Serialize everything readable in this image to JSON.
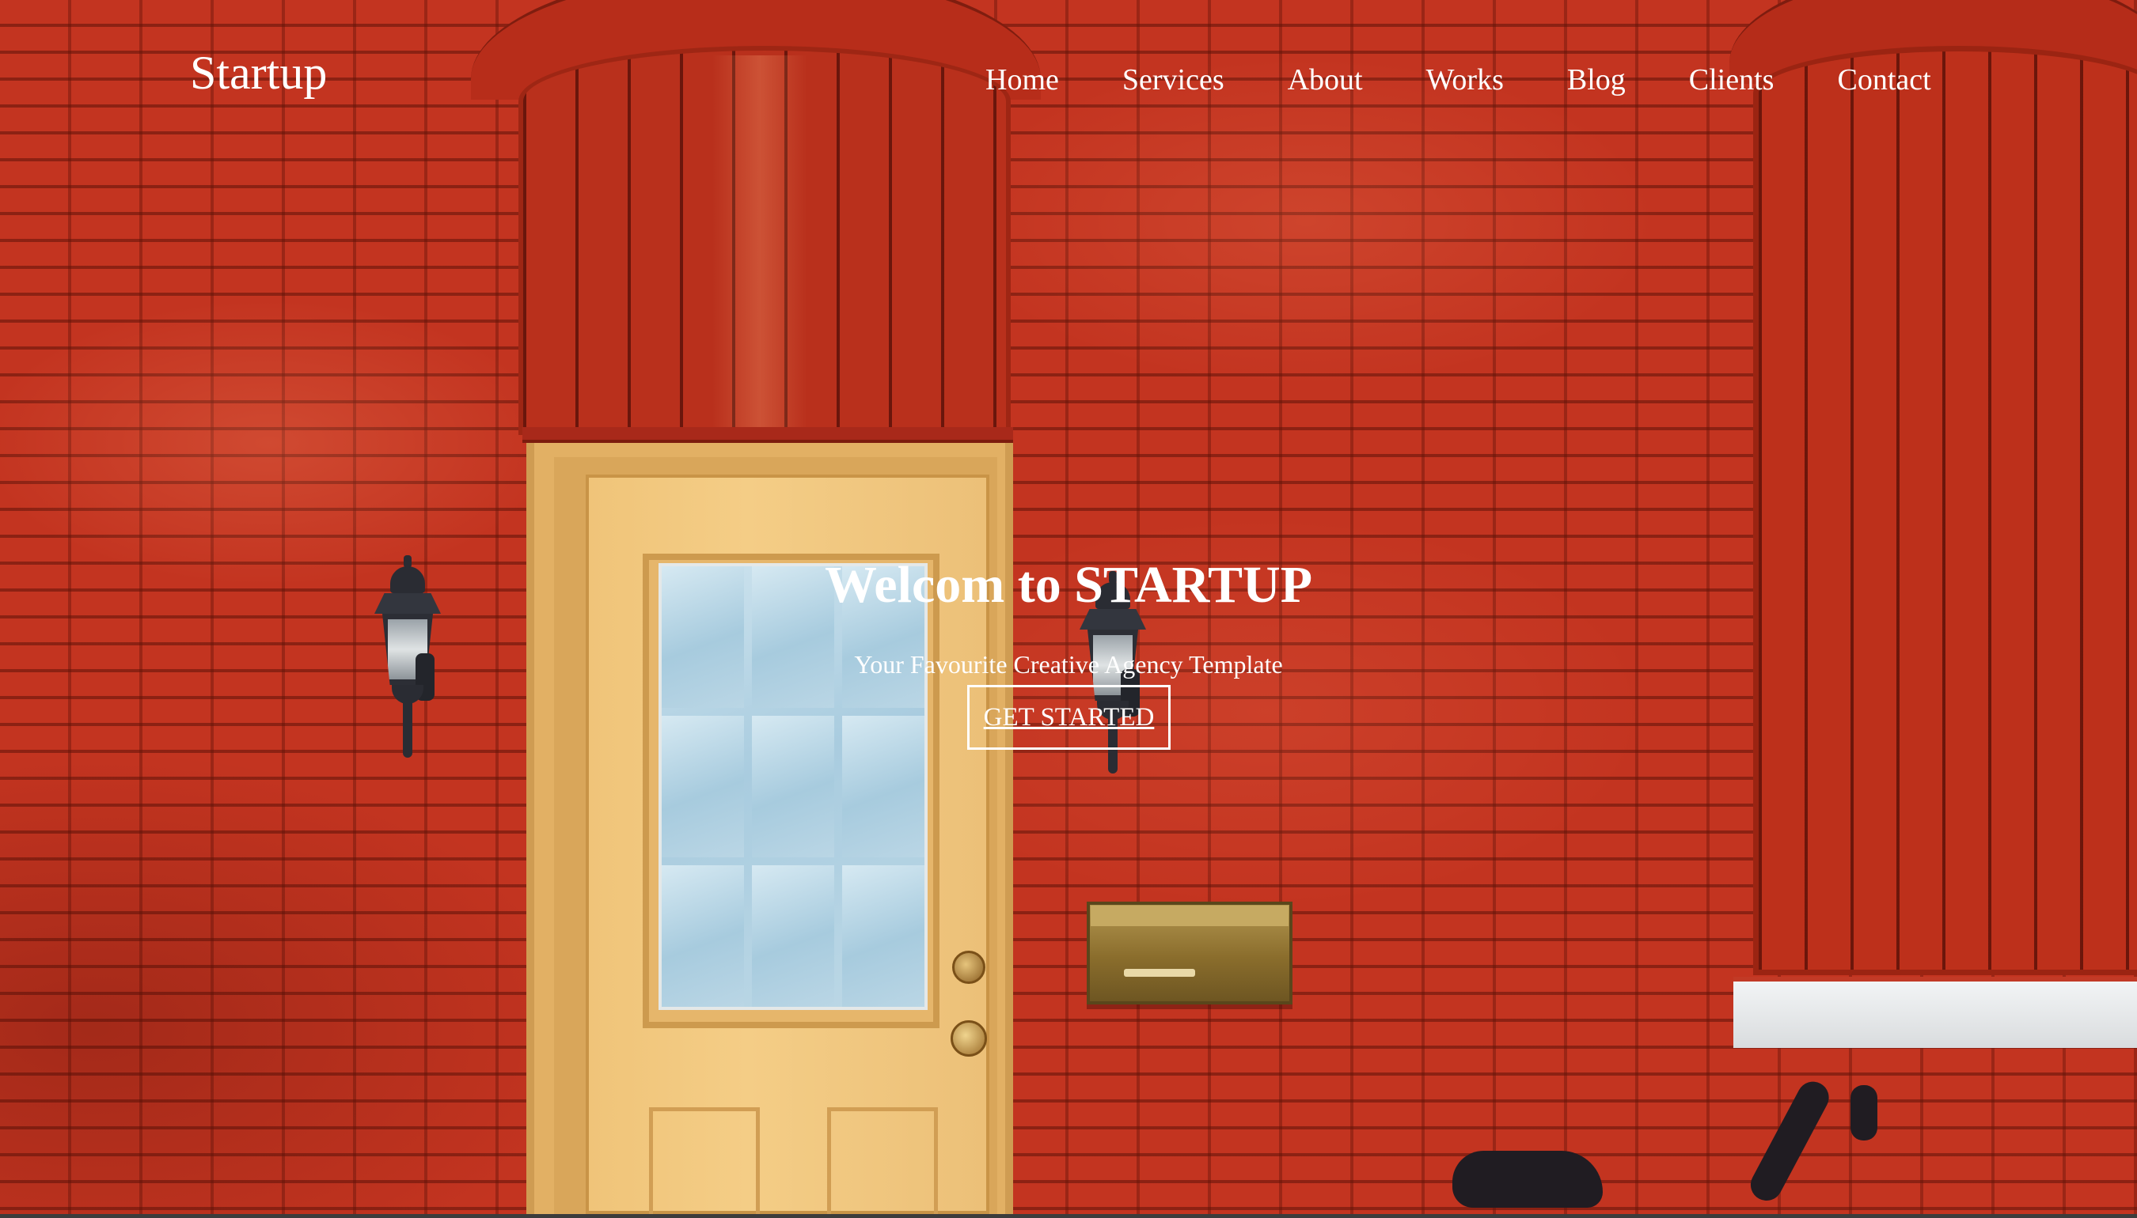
{
  "header": {
    "logo_text": "Startup",
    "nav": [
      {
        "label": "Home"
      },
      {
        "label": "Services"
      },
      {
        "label": "About"
      },
      {
        "label": "Works"
      },
      {
        "label": "Blog"
      },
      {
        "label": "Clients"
      },
      {
        "label": "Contact"
      }
    ]
  },
  "hero": {
    "title": "Welcom to STARTUP",
    "subtitle": "Your Favourite Creative Agency Template",
    "cta_label": "GET STARTED",
    "background": "red-brick-wall-door-photo"
  },
  "colors": {
    "text": "#ffffff",
    "brick": "#c33420",
    "door": "#f0c479"
  }
}
